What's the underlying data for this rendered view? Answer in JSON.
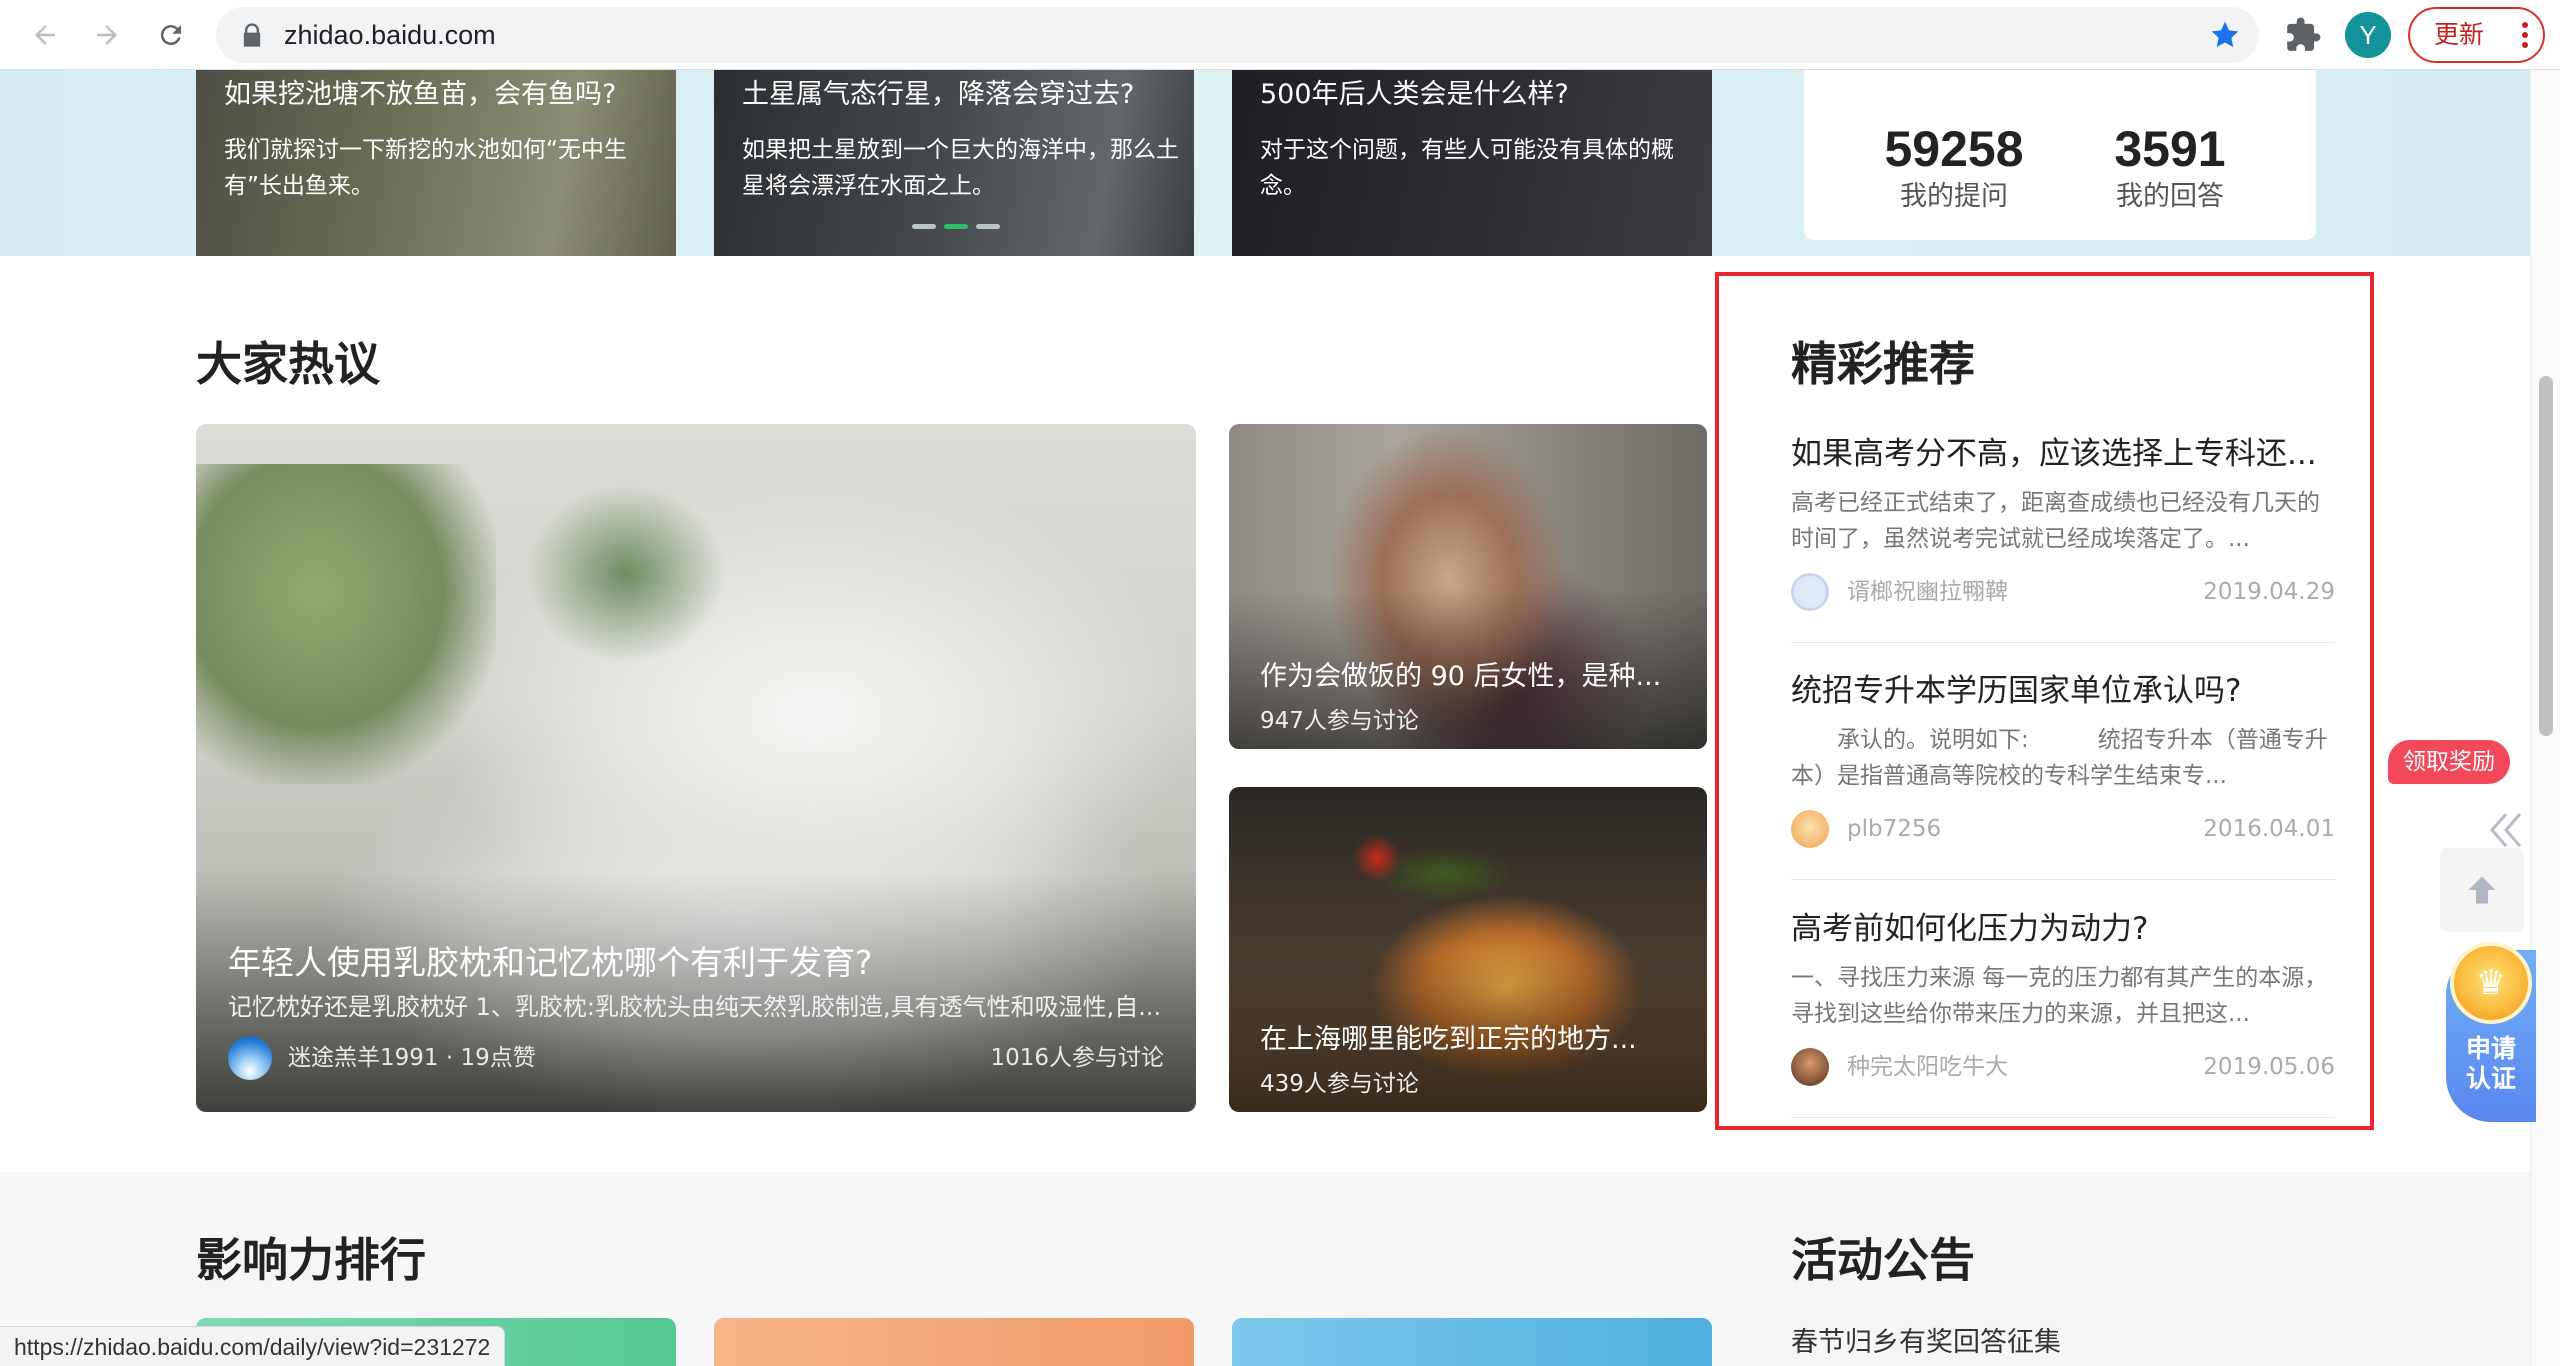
{
  "browser": {
    "url": "zhidao.baidu.com",
    "profile_initial": "Y",
    "update_label": "更新"
  },
  "banner": {
    "cards": [
      {
        "title": "如果挖池塘不放鱼苗，会有鱼吗?",
        "desc": "我们就探讨一下新挖的水池如何“无中生有”长出鱼来。"
      },
      {
        "title": "土星属气态行星，降落会穿过去?",
        "desc": "如果把土星放到一个巨大的海洋中，那么土星将会漂浮在水面之上。"
      },
      {
        "title": "500年后人类会是什么样?",
        "desc": "对于这个问题，有些人可能没有具体的概念。"
      }
    ],
    "stats": {
      "questions_num": "59258",
      "questions_label": "我的提问",
      "answers_num": "3591",
      "answers_label": "我的回答"
    }
  },
  "hot": {
    "title": "大家热议",
    "main": {
      "title": "年轻人使用乳胶枕和记忆枕哪个有利于发育?",
      "desc": "记忆枕好还是乳胶枕好 1、乳胶枕:乳胶枕头由纯天然乳胶制造,具有透气性和吸湿性,自...",
      "author": "迷途羔羊1991 · 19点赞",
      "count": "1016人参与讨论"
    },
    "side": [
      {
        "title": "作为会做饭的 90 后女性，是种...",
        "count": "947人参与讨论"
      },
      {
        "title": "在上海哪里能吃到正宗的地方...",
        "count": "439人参与讨论"
      }
    ]
  },
  "recommend": {
    "title": "精彩推荐",
    "items": [
      {
        "q": "如果高考分不高，应该选择上专科还...",
        "a": "高考已经正式结束了，距离查成绩也已经没有几天的时间了，虽然说考完试就已经成埃落定了。...",
        "user": "谞榔祝豳拉翈鞞",
        "date": "2019.04.29"
      },
      {
        "q": "统招专升本学历国家单位承认吗?",
        "a": "承认的。说明如下:　　　统招专升本（普通专升本）是指普通高等院校的专科学生结束专...",
        "user": "plb7256",
        "date": "2016.04.01"
      },
      {
        "q": "高考前如何化压力为动力?",
        "a": "一、寻找压力来源 每一克的压力都有其产生的本源，寻找到这些给你带来压力的来源，并且把这...",
        "user": "种完太阳吃牛大",
        "date": "2019.05.06"
      }
    ]
  },
  "bottom": {
    "rank_title": "影响力排行",
    "activity_title": "活动公告",
    "activity_item": "春节归乡有奖回答征集"
  },
  "widgets": {
    "reward_label": "领取奖励",
    "apply_label_1": "申请",
    "apply_label_2": "认证"
  },
  "status_url": "https://zhidao.baidu.com/daily/view?id=231272"
}
